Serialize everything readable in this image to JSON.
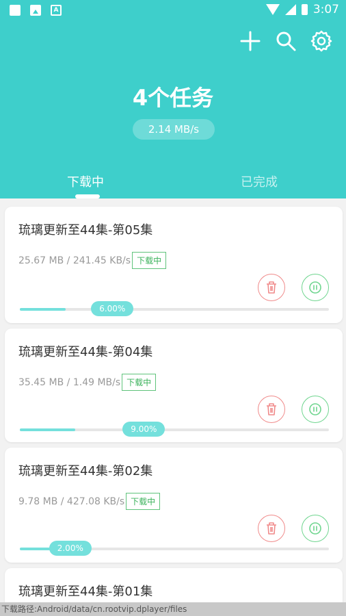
{
  "status_bar": {
    "time": "3:07",
    "left_icons": [
      "square-icon",
      "image-icon",
      "a-icon"
    ],
    "right_icons": [
      "wifi-icon",
      "signal-icon",
      "battery-icon"
    ]
  },
  "toolbar": {
    "icons": [
      "plus-icon",
      "search-icon",
      "gear-icon"
    ]
  },
  "summary": {
    "task_count": "4个任务",
    "speed": "2.14 MB/s"
  },
  "tabs": [
    {
      "label": "下载中",
      "active": true
    },
    {
      "label": "已完成",
      "active": false
    }
  ],
  "tasks": [
    {
      "title": "琉璃更新至44集-第05集",
      "meta": "25.67 MB / 241.45 KB/s",
      "status": "下载中",
      "progress_label": "6.00%",
      "progress": 0.06
    },
    {
      "title": "琉璃更新至44集-第04集",
      "meta": "35.45 MB / 1.49 MB/s",
      "status": "下载中",
      "progress_label": "9.00%",
      "progress": 0.09
    },
    {
      "title": "琉璃更新至44集-第02集",
      "meta": "9.78 MB / 427.08 KB/s",
      "status": "下载中",
      "progress_label": "2.00%",
      "progress": 0.02
    },
    {
      "title": "琉璃更新至44集-第01集"
    }
  ],
  "footer": {
    "path": "下载路径:Android/data/cn.rootvip.dplayer/files"
  },
  "colors": {
    "accent": "#3ecfcb",
    "delete": "#f08a8a",
    "pause": "#6ed58e",
    "badge": "#3bb25b"
  }
}
